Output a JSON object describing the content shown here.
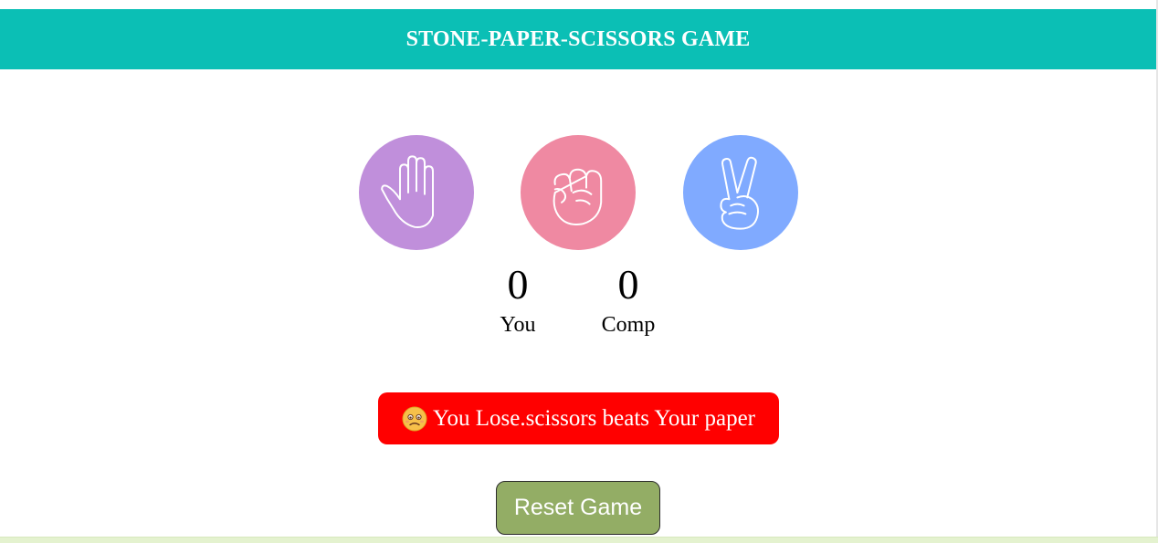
{
  "header": {
    "title": "STONE-PAPER-SCISSORS GAME"
  },
  "choices": [
    {
      "id": "paper",
      "icon": "paper-hand-icon",
      "color": "#c08fdb"
    },
    {
      "id": "stone",
      "icon": "fist-icon",
      "color": "#ef89a2"
    },
    {
      "id": "scissors",
      "icon": "scissors-hand-icon",
      "color": "#80aaff"
    }
  ],
  "score": {
    "you_value": "0",
    "you_label": "You",
    "comp_value": "0",
    "comp_label": "Comp"
  },
  "message": {
    "text": "You Lose.scissors beats Your paper",
    "emoji": "sad-face-icon",
    "bg_color": "#ff0000"
  },
  "reset": {
    "label": "Reset Game",
    "color": "#93ad65"
  },
  "colors": {
    "header_bg": "#0bbfb5"
  }
}
